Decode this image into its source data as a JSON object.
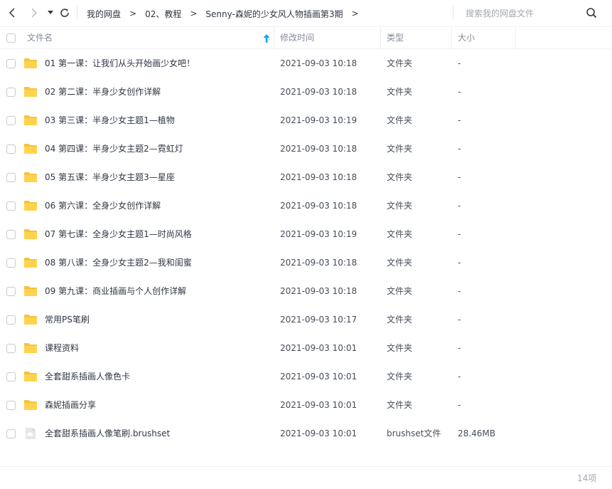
{
  "nav": {
    "back_icon": "chevron-left-icon",
    "forward_icon": "chevron-right-icon",
    "dropdown_icon": "caret-down-icon",
    "refresh_icon": "refresh-icon"
  },
  "breadcrumb": {
    "items": [
      "我的网盘",
      "02、教程",
      "Senny-森妮的少女风人物插画第3期"
    ],
    "separator": ">"
  },
  "search": {
    "placeholder": "搜索我的网盘文件",
    "value": "",
    "icon": "search-icon"
  },
  "table": {
    "headers": {
      "name": "文件名",
      "modified": "修改时间",
      "type": "类型",
      "size": "大小"
    },
    "sort_icon": "arrow-up-icon",
    "rows": [
      {
        "name": "01 第一课：让我们从头开始画少女吧！",
        "modified": "2021-09-03 10:18",
        "type": "文件夹",
        "size": "-",
        "icon": "folder-icon"
      },
      {
        "name": "02 第二课：半身少女创作详解",
        "modified": "2021-09-03 10:18",
        "type": "文件夹",
        "size": "-",
        "icon": "folder-icon"
      },
      {
        "name": "03 第三课：半身少女主题1—植物",
        "modified": "2021-09-03 10:19",
        "type": "文件夹",
        "size": "-",
        "icon": "folder-icon"
      },
      {
        "name": "04 第四课：半身少女主题2—霓虹灯",
        "modified": "2021-09-03 10:18",
        "type": "文件夹",
        "size": "-",
        "icon": "folder-icon"
      },
      {
        "name": "05 第五课：半身少女主题3—星座",
        "modified": "2021-09-03 10:18",
        "type": "文件夹",
        "size": "-",
        "icon": "folder-icon"
      },
      {
        "name": "06 第六课：全身少女创作详解",
        "modified": "2021-09-03 10:18",
        "type": "文件夹",
        "size": "-",
        "icon": "folder-icon"
      },
      {
        "name": "07 第七课：全身少女主题1—时尚风格",
        "modified": "2021-09-03 10:19",
        "type": "文件夹",
        "size": "-",
        "icon": "folder-icon"
      },
      {
        "name": "08 第八课：全身少女主题2—我和闺蜜",
        "modified": "2021-09-03 10:18",
        "type": "文件夹",
        "size": "-",
        "icon": "folder-icon"
      },
      {
        "name": "09 第九课：商业插画与个人创作详解",
        "modified": "2021-09-03 10:18",
        "type": "文件夹",
        "size": "-",
        "icon": "folder-icon"
      },
      {
        "name": "常用PS笔刷",
        "modified": "2021-09-03 10:17",
        "type": "文件夹",
        "size": "-",
        "icon": "folder-icon"
      },
      {
        "name": "课程资料",
        "modified": "2021-09-03 10:01",
        "type": "文件夹",
        "size": "-",
        "icon": "folder-icon"
      },
      {
        "name": "全套甜系插画人像色卡",
        "modified": "2021-09-03 10:01",
        "type": "文件夹",
        "size": "-",
        "icon": "folder-icon"
      },
      {
        "name": "森妮插画分享",
        "modified": "2021-09-03 10:01",
        "type": "文件夹",
        "size": "-",
        "icon": "folder-icon"
      },
      {
        "name": "全套甜系插画人像笔刷.brushset",
        "modified": "2021-09-03 10:01",
        "type": "brushset文件",
        "size": "28.46MB",
        "icon": "file-icon"
      }
    ]
  },
  "footer": {
    "count": "14项"
  },
  "colors": {
    "folder": "#ffd34d",
    "folder_dark": "#f5c33b",
    "accent": "#06a7ff",
    "text": "#2f3744",
    "muted": "#a2a8b1"
  }
}
